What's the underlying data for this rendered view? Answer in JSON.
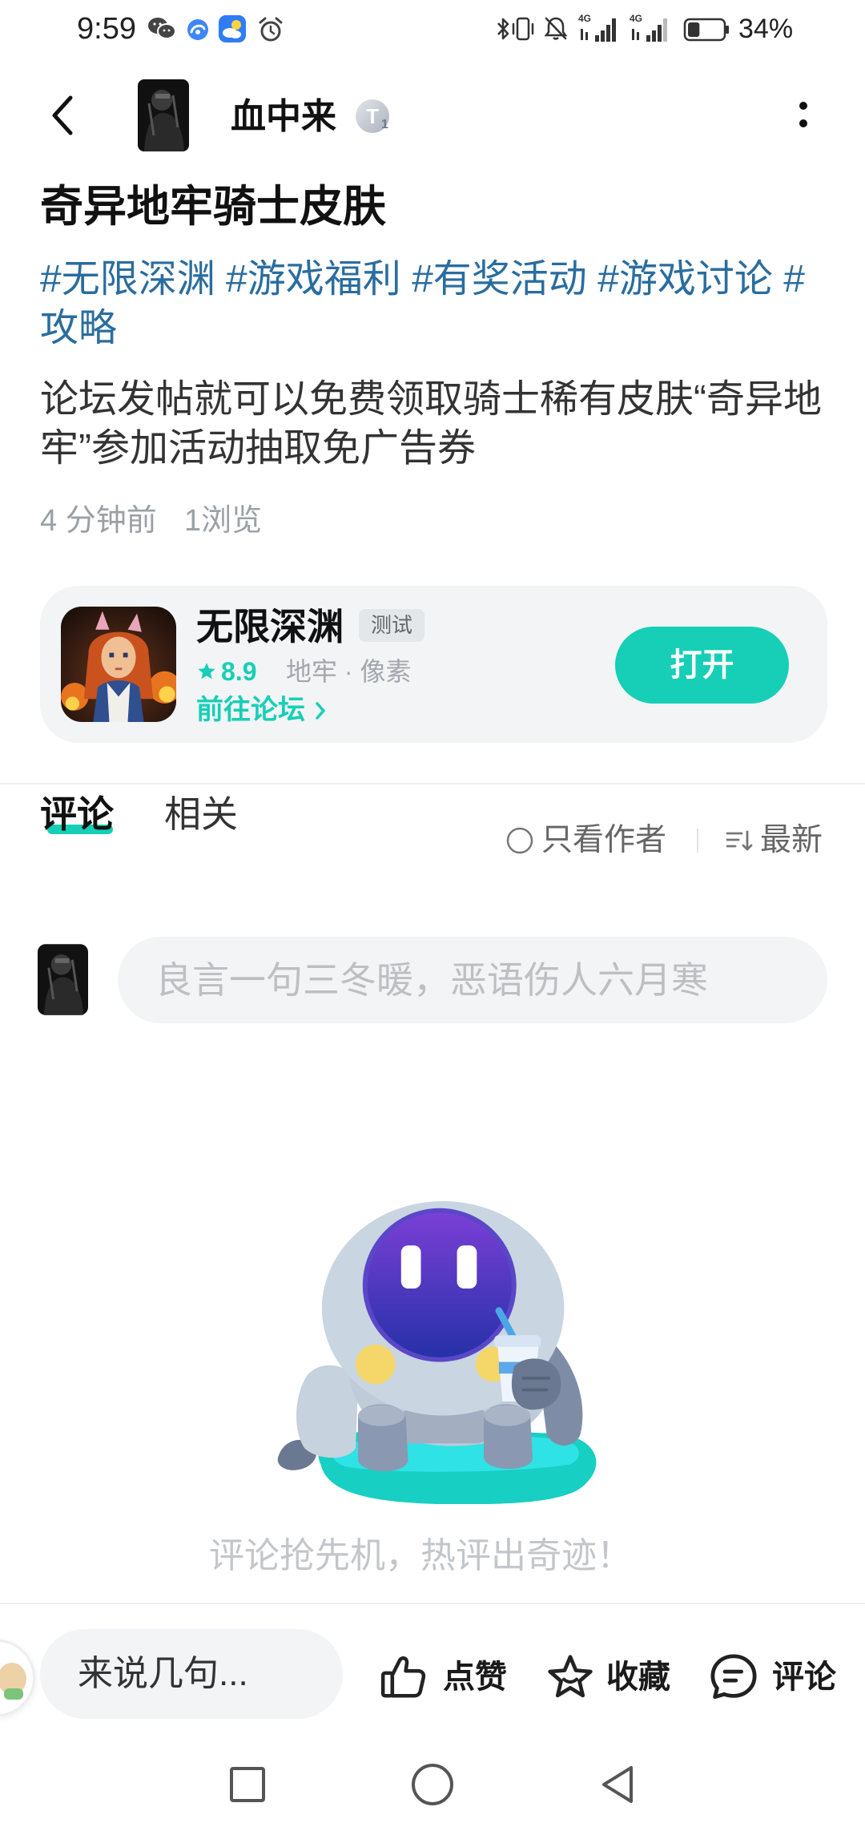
{
  "status_bar": {
    "time": "9:59",
    "left_icons": [
      "wechat-icon",
      "browser-icon",
      "weather-icon",
      "alarm-icon"
    ],
    "right_icons": [
      "bluetooth-icon",
      "vibrate-icon",
      "mute-icon",
      "signal-icon",
      "signal-icon",
      "battery-icon"
    ],
    "network_1": "4G",
    "network_2": "4G",
    "battery_percent": "34%"
  },
  "header": {
    "back_icon": "back-arrow-icon",
    "author_name": "血中来",
    "badge_letter": "T",
    "badge_level": "1",
    "more_icon": "more-icon"
  },
  "post": {
    "title": "奇异地牢骑士皮肤",
    "tags": [
      "#无限深渊",
      "#游戏福利",
      "#有奖活动",
      "#游戏讨论",
      "#攻略"
    ],
    "body": "论坛发帖就可以免费领取骑士稀有皮肤“奇异地牢”参加活动抽取免广告券",
    "time_ago": "4 分钟前",
    "views": "1浏览"
  },
  "game_card": {
    "name": "无限深渊",
    "tag": "测试",
    "rating": "8.9",
    "genres": "地牢 · 像素",
    "forum_link": "前往论坛",
    "open_button": "打开",
    "icons": [
      "star-icon",
      "chevron-right-icon",
      "game-icon"
    ]
  },
  "tabs": [
    {
      "label": "评论",
      "active": true
    },
    {
      "label": "相关",
      "active": false
    }
  ],
  "filters": {
    "author_only": "只看作者",
    "sort": "最新"
  },
  "comment_box": {
    "placeholder": "良言一句三冬暖，恶语伤人六月寒"
  },
  "empty_state": {
    "message": "评论抢先机，热评出奇迹！"
  },
  "bottom_bar": {
    "input_text": "来说几句...",
    "like": "点赞",
    "collect": "收藏",
    "comment": "评论",
    "icons": [
      "thumbs-up-icon",
      "star-icon",
      "comment-icon"
    ]
  },
  "nav_bar": {
    "icons": [
      "recent-apps-icon",
      "home-icon",
      "back-icon"
    ]
  },
  "colors": {
    "accent": "#16cfb6",
    "tag_link": "#2a6d9f",
    "text": "#1a1a1a",
    "muted": "#9aa0a6",
    "card_bg": "#f2f4f6"
  }
}
